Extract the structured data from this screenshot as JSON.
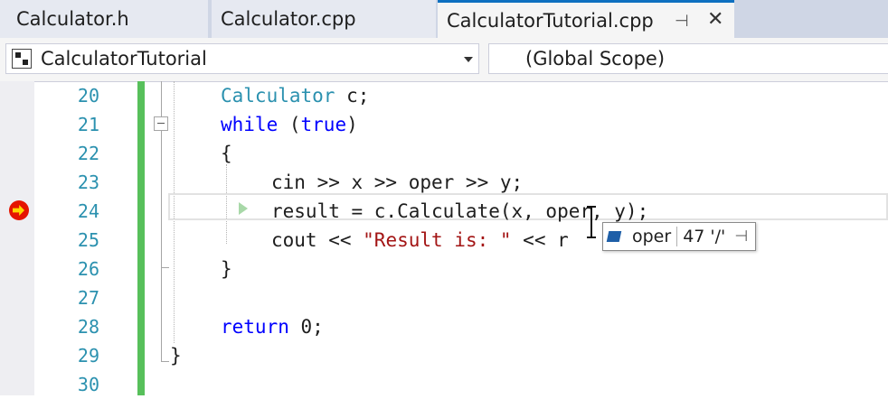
{
  "tabs": [
    {
      "label": "Calculator.h",
      "active": false
    },
    {
      "label": "Calculator.cpp",
      "active": false
    },
    {
      "label": "CalculatorTutorial.cpp",
      "active": true
    }
  ],
  "tab_actions": {
    "pin_glyph": "⊣",
    "close_glyph": "✕"
  },
  "navbar": {
    "project": "CalculatorTutorial",
    "scope": "(Global Scope)"
  },
  "editor": {
    "line_numbers": [
      "20",
      "21",
      "22",
      "23",
      "24",
      "25",
      "26",
      "27",
      "28",
      "29",
      "30"
    ],
    "current_line": "24",
    "breakpoint_line": "24",
    "lines": {
      "l20": {
        "type": "Calculator",
        "rest": " c;"
      },
      "l21": {
        "kw": "while",
        "rest1": " (",
        "kw2": "true",
        "rest2": ")"
      },
      "l22": {
        "text": "{"
      },
      "l23": {
        "text": "cin >> x >> oper >> y;"
      },
      "l24": {
        "text": "result = c.Calculate(x, oper, y);"
      },
      "l25": {
        "pre": "cout << ",
        "str": "\"Result is: \"",
        "post": " << r"
      },
      "l26": {
        "text": "}"
      },
      "l27": {
        "text": ""
      },
      "l28": {
        "kw": "return",
        "rest": " 0;"
      },
      "l29": {
        "text": "}"
      },
      "l30": {
        "text": ""
      }
    }
  },
  "datatip": {
    "variable": "oper",
    "value": "47 '/'",
    "pin_glyph": "⊣"
  },
  "colors": {
    "keyword": "#0000ff",
    "type": "#2b91af",
    "string": "#a31515",
    "line_number": "#2b91af",
    "change_bar": "#57c05b",
    "active_tab_accent": "#0e70c0",
    "breakpoint": "#e51400",
    "instruction_pointer": "#ffd400"
  }
}
